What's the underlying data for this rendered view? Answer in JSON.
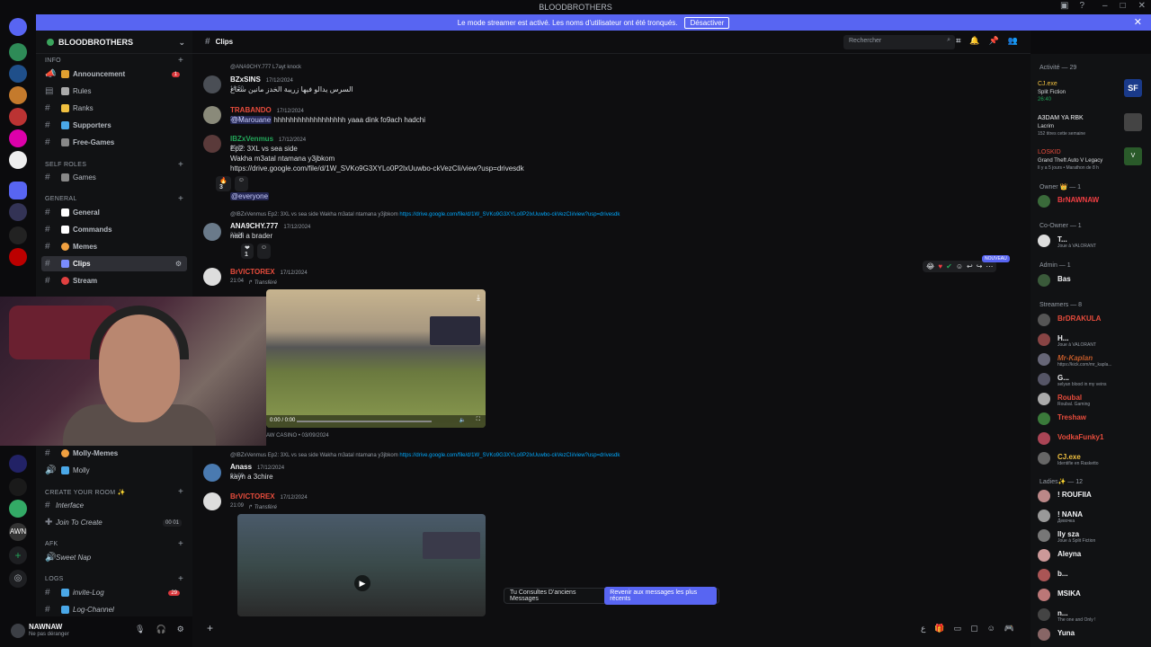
{
  "window": {
    "title": "BLOODBROTHERS"
  },
  "banner": {
    "text": "Le mode streamer est activé. Les noms d'utilisateur ont été tronqués.",
    "button": "Désactiver"
  },
  "guild": {
    "name": "BLOODBROTHERS"
  },
  "categories": {
    "info": "INFO",
    "self_roles": "Self Roles",
    "general": "GENERAL",
    "create_room": "CREATE YOUR ROOM ✨",
    "afk": "AFK",
    "logs": "LOGS"
  },
  "channels": {
    "announcement": "Announcement",
    "announcement_badge": "1",
    "rules": "Rules",
    "ranks": "Ranks",
    "supporters": "Supporters",
    "free_games": "Free-Games",
    "games": "Games",
    "general": "General",
    "commands": "Commands",
    "memes": "Memes",
    "clips": "Clips",
    "stream": "Stream",
    "molly_memes": "Molly-Memes",
    "molly": "Molly",
    "interface": "Interface",
    "join_to_create": "Join To Create",
    "join_count": "00 01",
    "sweet_nap": "Sweet Nap",
    "invite_log": "invite-Log",
    "invite_badge": "29",
    "log_channel": "Log-Channel"
  },
  "user": {
    "name": "NAWNAW",
    "status": "Ne pas déranger"
  },
  "header": {
    "channel": "Clips",
    "search_placeholder": "Rechercher"
  },
  "messages": {
    "m1_reply": "@ANA9CHY.777 L7ayt knock",
    "m1_name": "BZxSINS",
    "m1_time": "17/12/2024 16:50",
    "m1_text": "السرس يدالو فيها زريبة الخدز مانين سعاع",
    "m2_name": "TRABANDO",
    "m2_time": "17/12/2024 20:37",
    "m2_mention": "@Marouane",
    "m2_text": "hhhhhhhhhhhhhhhhhh yaaa dink fo9ach hadchi",
    "m3_name": "IBZxVenmus",
    "m3_time": "17/12/2024 20:52",
    "m3_line1": "Ep2: 3XL vs sea side",
    "m3_line2": "Wakha m3atal ntamana y3jbkom",
    "m3_link": "https://drive.google.com/file/d/1W_SVKo9G3XYLo0P2lxUuwbo-ckVezCIi/view?usp=drivesdk",
    "m3_react": "3",
    "m3_mention": "@everyone",
    "m4_reply": "@IBZxVenmus Ep2: 3XL vs sea side Wakha m3atal ntamana y3jbkom",
    "m4_reply_link": "https://drive.google.com/file/d/1W_SVKo9G3XYLo0P2lxUuwbo-ckVezCIi/view?usp=drivesdk",
    "m4_name": "ANA9CHY.777",
    "m4_time": "17/12/2024 21:06",
    "m4_text": "nadi a brader",
    "m4_react": "1",
    "m5_name": "BrVICTOREX",
    "m5_time": "17/12/2024 21:04",
    "m5_fwd": "Transféré",
    "m5_video_time": "0:00 / 0:00",
    "m5_footer": "AW CASINO • 03/09/2024",
    "nouveau": "NOUVEAU",
    "m6_reply": "@IBZxVenmus Ep2: 3XL vs sea side Wakha m3atal ntamana y3jbkom",
    "m6_reply_link": "https://drive.google.com/file/d/1W_SVKo9G3XYLo0P2lxUuwbo-ckVezCIi/view?usp=drivesdk",
    "m6_name": "Anass",
    "m6_time": "17/12/2024 21:09",
    "m6_text": "kayn a 3chire",
    "m7_name": "BrVICTOREX",
    "m7_time": "17/12/2024 21:09",
    "m7_fwd": "Transféré"
  },
  "toast": {
    "left": "Tu Consultes D'anciens Messages",
    "button": "Revenir aux messages les plus récents"
  },
  "members": {
    "activity_header": "Activité — 29",
    "a1_name": "CJ.exe",
    "a1_game": "Split Fiction",
    "a1_time": "26:40",
    "a2_name": "A3DAM YA RBK",
    "a2_game": "Lacrim",
    "a2_sub": "152 titres cette semaine",
    "a3_name": "LOSKID",
    "a3_game": "Grand Theft Auto V Legacy",
    "a3_sub": "Il y a 5 jours • Marathon de 8 h",
    "owner_cat": "Owner 👑 — 1",
    "owner_name": "BrNAWNAW",
    "coowner_cat": "Co-Owner — 1",
    "coowner_name": "T...",
    "coowner_sub": "Joue à VALORANT",
    "admin_cat": "Admin — 1",
    "admin_name": "Bas",
    "streamers_cat": "Streamers — 8",
    "s1": "BrDRAKULA",
    "s2": "H...",
    "s2_sub": "Joue à VALORANT",
    "s3": "Mr-Kaplan",
    "s3_sub": "https://kick.com/mr_kapla...",
    "s4": "G...",
    "s4_sub": "selyan blood in my veins",
    "s5": "Roubal",
    "s5_sub": "Roubal. Gaming",
    "s6": "Treshaw",
    "s7": "VodkaFunky1",
    "s8": "CJ.exe",
    "s8_sub": "Identifie en Rasketto",
    "ladies_cat": "Ladies✨ — 12",
    "l1": "! ROUFIIA",
    "l2": "! NANA",
    "l2_sub": "Девочка",
    "l3": "lly sza",
    "l3_sub": "Joue à Split Fiction",
    "l4": "Aleyna",
    "l5": "b...",
    "l6": "MSIKA",
    "l7": "n...",
    "l7_sub": "The one and Only !",
    "l8": "Yuna"
  },
  "colors": {
    "accent": "#5865f2",
    "owner": "#f23f43",
    "green": "#23a559",
    "link": "#00a8fc"
  }
}
